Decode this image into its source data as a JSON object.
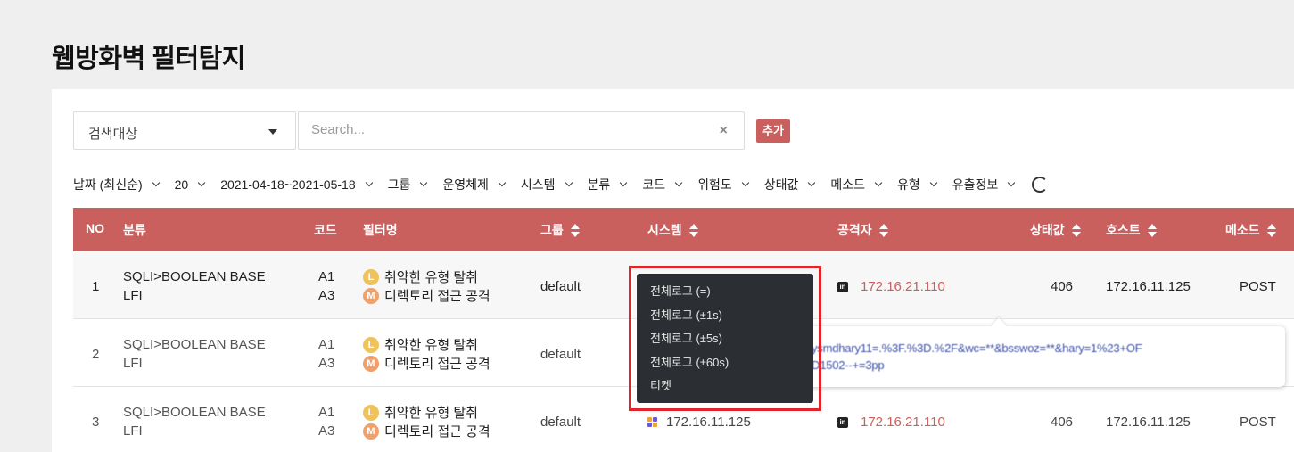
{
  "page": {
    "title": "웹방화벽 필터탐지"
  },
  "search": {
    "target_label": "검색대상",
    "placeholder": "Search...",
    "clear_icon": "×",
    "add_label": "추가"
  },
  "filters": [
    {
      "label": "날짜 (최신순)"
    },
    {
      "label": "20"
    },
    {
      "label": "2021-04-18~2021-05-18"
    },
    {
      "label": "그룹"
    },
    {
      "label": "운영체제"
    },
    {
      "label": "시스템"
    },
    {
      "label": "분류"
    },
    {
      "label": "코드"
    },
    {
      "label": "위험도"
    },
    {
      "label": "상태값"
    },
    {
      "label": "메소드"
    },
    {
      "label": "유형"
    },
    {
      "label": "유출정보"
    }
  ],
  "table": {
    "headers": {
      "no": "NO",
      "category": "분류",
      "code": "코드",
      "filter_name": "필터명",
      "group": "그룹",
      "system": "시스템",
      "attacker": "공격자",
      "status": "상태값",
      "host": "호스트",
      "method": "메소드"
    },
    "rows": [
      {
        "no": "1",
        "category": [
          "SQLI>BOOLEAN BASE",
          "LFI"
        ],
        "code": [
          "A1",
          "A3"
        ],
        "filters": [
          {
            "badge": "L",
            "name": "취약한 유형 탈취"
          },
          {
            "badge": "M",
            "name": "디렉토리 접근 공격"
          }
        ],
        "group": "default",
        "system": "",
        "attacker": "172.16.21.110",
        "status": "406",
        "host": "172.16.11.125",
        "method": "POST"
      },
      {
        "no": "2",
        "category": [
          "SQLI>BOOLEAN BASE",
          "LFI"
        ],
        "code": [
          "A1",
          "A3"
        ],
        "filters": [
          {
            "badge": "L",
            "name": "취약한 유형 탈취"
          },
          {
            "badge": "M",
            "name": "디렉토리 접근 공격"
          }
        ],
        "group": "default",
        "system": "",
        "attacker": "",
        "status": "",
        "host": "",
        "method": ""
      },
      {
        "no": "3",
        "category": [
          "SQLI>BOOLEAN BASE",
          "LFI"
        ],
        "code": [
          "A1",
          "A3"
        ],
        "filters": [
          {
            "badge": "L",
            "name": "취약한 유형 탈취"
          },
          {
            "badge": "M",
            "name": "디렉토리 접근 공격"
          }
        ],
        "group": "default",
        "system": "172.16.11.125",
        "attacker": "172.16.21.110",
        "status": "406",
        "host": "172.16.11.125",
        "method": "POST"
      }
    ]
  },
  "tooltip": {
    "lines": [
      "ysmdhary11=.%3F.%3D.%2F&wc=**&bsswoz=**&hary=1%23+OF",
      "D1502--+=3pp"
    ]
  },
  "context_menu": {
    "items": [
      "전체로그 (=)",
      "전체로그 (±1s)",
      "전체로그 (±5s)",
      "전체로그 (±60s)",
      "티켓"
    ]
  },
  "colors": {
    "header_bg": "#c9605e",
    "accent": "#c9605e",
    "menu_bg": "#2b2e33",
    "highlight_frame": "#e0242a",
    "badge_l": "#efc25a",
    "badge_m": "#f0a06a"
  }
}
